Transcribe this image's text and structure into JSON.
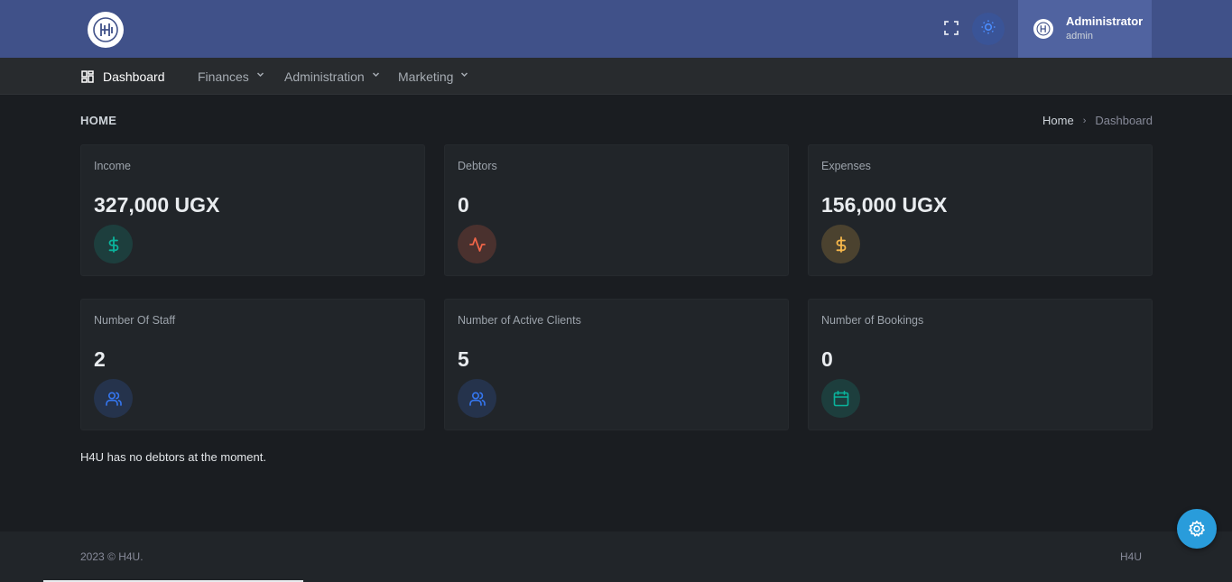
{
  "header": {
    "logo_icon": "h4u-logo",
    "fullscreen_icon": "fullscreen-icon",
    "theme_icon": "sun-icon",
    "user": {
      "name": "Administrator",
      "role": "admin"
    }
  },
  "nav": {
    "items": [
      {
        "label": "Dashboard",
        "icon": "dashboard-icon",
        "active": true
      },
      {
        "label": "Finances",
        "dropdown": true
      },
      {
        "label": "Administration",
        "dropdown": true
      },
      {
        "label": "Marketing",
        "dropdown": true
      }
    ]
  },
  "page": {
    "title": "HOME",
    "breadcrumb": {
      "home": "Home",
      "separator": "›",
      "current": "Dashboard"
    }
  },
  "cards": [
    {
      "label": "Income",
      "value": "327,000 UGX",
      "icon": "dollar-icon",
      "color": "#0ab39c"
    },
    {
      "label": "Debtors",
      "value": "0",
      "icon": "activity-icon",
      "color": "#f06548"
    },
    {
      "label": "Expenses",
      "value": "156,000 UGX",
      "icon": "dollar-icon",
      "color": "#f7b84b"
    },
    {
      "label": "Number Of Staff",
      "value": "2",
      "icon": "users-icon",
      "color": "#3577f1"
    },
    {
      "label": "Number of Active Clients",
      "value": "5",
      "icon": "users-icon",
      "color": "#3577f1"
    },
    {
      "label": "Number of Bookings",
      "value": "0",
      "icon": "calendar-icon",
      "color": "#0ab39c"
    }
  ],
  "message": "H4U has no debtors at the moment.",
  "footer": {
    "left": "2023 © H4U.",
    "right": "H4U"
  },
  "colors": {
    "topbar": "#405189",
    "accent": "#299cdb"
  }
}
